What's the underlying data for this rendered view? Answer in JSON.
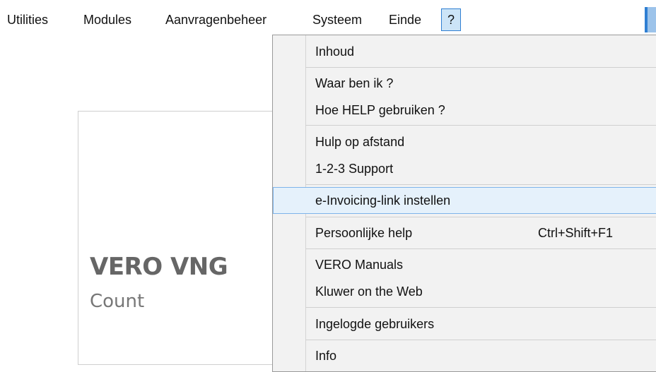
{
  "menubar": {
    "items": [
      {
        "label": "Utilities"
      },
      {
        "label": "Modules"
      },
      {
        "label": "Aanvragenbeheer"
      },
      {
        "label": "Systeem"
      },
      {
        "label": "Einde"
      },
      {
        "label": "?"
      }
    ],
    "active_index": 5
  },
  "logo": {
    "title": "VERO VNG",
    "subtitle": "Count"
  },
  "help_menu": {
    "items": [
      {
        "label": "Inhoud",
        "shortcut": ""
      },
      {
        "label": "Waar ben ik ?",
        "shortcut": ""
      },
      {
        "label": "Hoe HELP gebruiken ?",
        "shortcut": ""
      },
      {
        "label": "Hulp op afstand",
        "shortcut": ""
      },
      {
        "label": "1-2-3 Support",
        "shortcut": ""
      },
      {
        "label": "e-Invoicing-link instellen",
        "shortcut": "",
        "highlighted": true
      },
      {
        "label": "Persoonlijke help",
        "shortcut": "Ctrl+Shift+F1"
      },
      {
        "label": "VERO Manuals",
        "shortcut": ""
      },
      {
        "label": "Kluwer on the Web",
        "shortcut": ""
      },
      {
        "label": "Ingelogde gebruikers",
        "shortcut": ""
      },
      {
        "label": "Info",
        "shortcut": ""
      }
    ]
  },
  "colors": {
    "accent": "#2f7fd2",
    "highlight_bg": "#e5f1fb",
    "menu_bg": "#f2f2f2"
  }
}
